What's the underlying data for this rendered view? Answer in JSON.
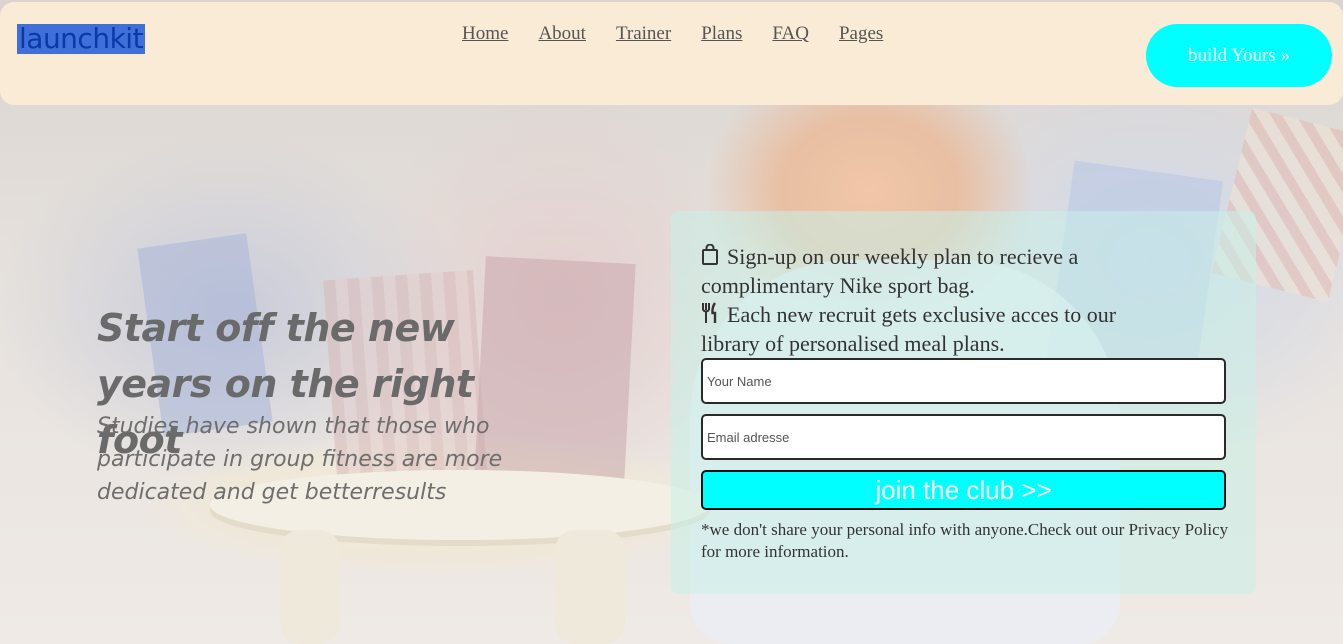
{
  "header": {
    "logo_text": "launchkit",
    "nav": [
      "Home",
      "About",
      "Trainer",
      "Plans",
      "FAQ",
      "Pages"
    ],
    "cta_label": "build Yours »"
  },
  "hero": {
    "title": "Start off the new years on the right foot",
    "subtitle": "Studies have shown that those who participate in group fitness are more dedicated and get betterresults"
  },
  "signup": {
    "perks": [
      {
        "icon": "shopping-bag-icon",
        "text": "Sign-up on our weekly plan to recieve a complimentary Nike sport bag."
      },
      {
        "icon": "fork-knife-icon",
        "text": "Each new recruit gets exclusive acces to our library of personalised meal plans."
      }
    ],
    "name_placeholder": "Your Name",
    "email_placeholder": "Email adresse",
    "submit_label": "join the club >>",
    "disclaimer": "*we don't share your personal info with anyone.Check out our Privacy Policy for more information."
  },
  "colors": {
    "header_bg": "#faebd7",
    "accent": "#00ffff",
    "logo": "#0a3aa8"
  }
}
